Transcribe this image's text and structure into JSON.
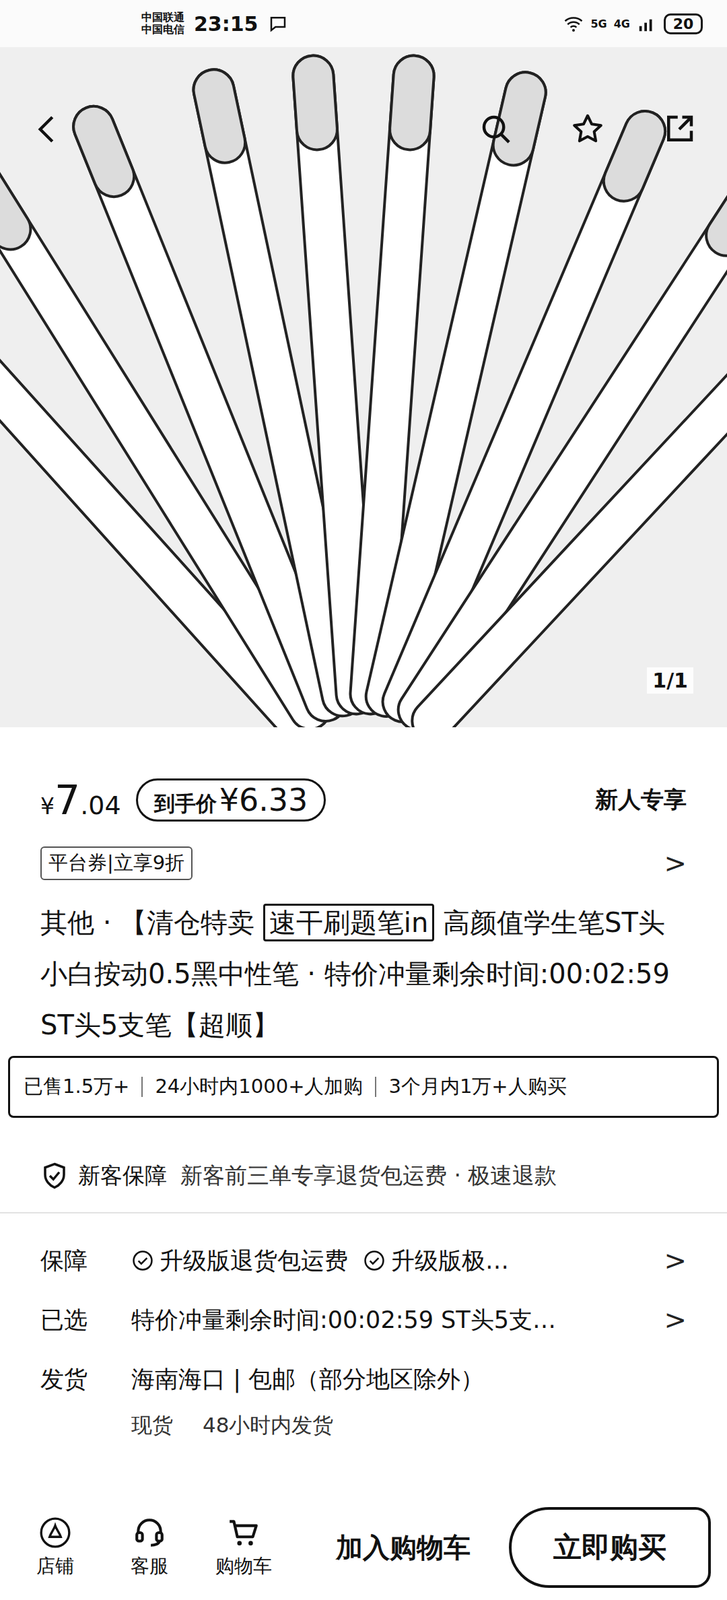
{
  "status_bar": {
    "carriers": [
      "中国联通",
      "中国电信"
    ],
    "time": "23:15",
    "networks": [
      "5G",
      "4G"
    ],
    "battery": "20"
  },
  "gallery": {
    "index": "1/1"
  },
  "price": {
    "currency": "¥",
    "main": "7",
    "decimal": ".04"
  },
  "final_price": {
    "label": "到手价",
    "value": "¥6.33"
  },
  "badge": "新人专享",
  "coupon": {
    "text": "平台券|立享9折",
    "chevron": ">"
  },
  "title": [
    {
      "text": "其他 · 【清仓特卖 ",
      "boxed": false
    },
    {
      "text": "速干刷题笔in",
      "boxed": true
    },
    {
      "text": " 高颜值学生笔ST头小白按动0.5黑中性笔 · 特价冲量剩余时间:00:02:59 ST头5支笔【超顺】",
      "boxed": false
    }
  ],
  "stats": [
    "已售1.5万+",
    "24小时内1000+人加购",
    "3个月内1万+人购买"
  ],
  "new_customer": {
    "label": "新客保障",
    "text": "新客前三单专享退货包运费 · 极速退款"
  },
  "rows": [
    {
      "kind": "checks",
      "label": "保障",
      "items": [
        "升级版退货包运费",
        "升级版极…"
      ],
      "chevron": ">"
    },
    {
      "kind": "text",
      "label": "已选",
      "text": "特价冲量剩余时间:00:02:59 ST头5支…",
      "chevron": ">"
    },
    {
      "kind": "shipping",
      "label": "发货",
      "text": "海南海口 | 包邮（部分地区除外）",
      "sub": [
        "现货",
        "48小时内发货"
      ]
    }
  ],
  "bottom_bar": {
    "icons": [
      {
        "label": "店铺"
      },
      {
        "label": "客服"
      },
      {
        "label": "购物车"
      }
    ],
    "add_to_cart": "加入购物车",
    "buy_now": "立即购买"
  }
}
